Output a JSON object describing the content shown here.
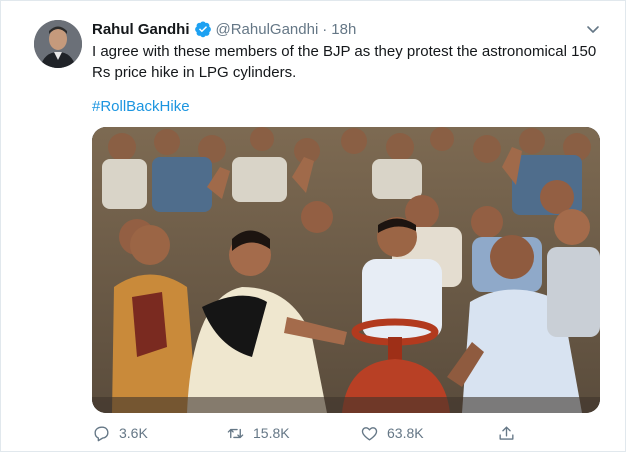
{
  "tweet": {
    "author_name": "Rahul Gandhi",
    "handle": "@RahulGandhi",
    "separator": "·",
    "time": "18h",
    "text": "I agree with these members of the BJP as they protest the astronomical 150 Rs price hike in LPG cylinders.",
    "hashtag": "#RollBackHike",
    "verified_icon": "verified-badge-icon",
    "menu_icon": "chevron-down-icon",
    "media": "protest-photo"
  },
  "actions": {
    "replies": "3.6K",
    "retweets": "15.8K",
    "likes": "63.8K",
    "reply_icon": "reply-icon",
    "retweet_icon": "retweet-icon",
    "like_icon": "heart-icon",
    "share_icon": "share-icon"
  },
  "colors": {
    "link": "#1b95e0",
    "secondary_text": "#657786",
    "verified": "#1da1f2"
  }
}
